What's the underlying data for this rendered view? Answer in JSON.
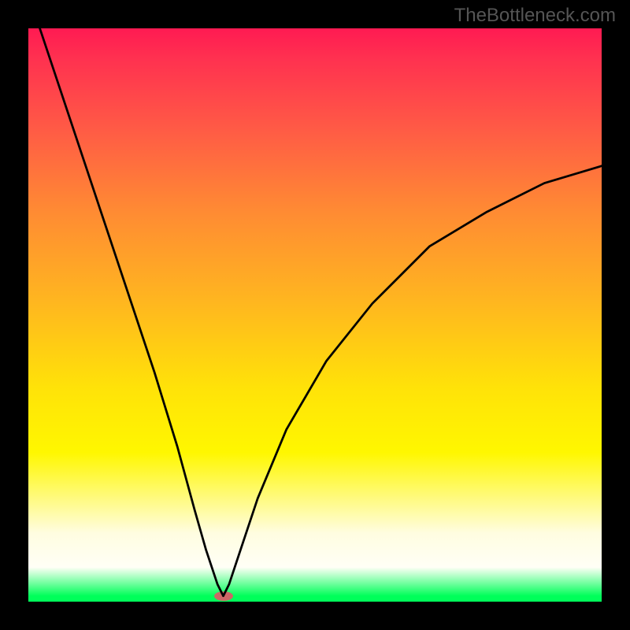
{
  "watermark": "TheBottleneck.com",
  "chart_data": {
    "type": "line",
    "title": "",
    "xlabel": "",
    "ylabel": "",
    "xlim": [
      0,
      100
    ],
    "ylim": [
      0,
      100
    ],
    "grid": false,
    "gradient_stops": [
      {
        "pos": 0,
        "color": "#ff1a52"
      },
      {
        "pos": 5,
        "color": "#ff3050"
      },
      {
        "pos": 18,
        "color": "#ff5c45"
      },
      {
        "pos": 32,
        "color": "#ff8b33"
      },
      {
        "pos": 48,
        "color": "#ffb71f"
      },
      {
        "pos": 63,
        "color": "#ffe308"
      },
      {
        "pos": 74,
        "color": "#fff700"
      },
      {
        "pos": 88,
        "color": "#fffde0"
      },
      {
        "pos": 94,
        "color": "#fffff6"
      },
      {
        "pos": 99,
        "color": "#00ff5a"
      },
      {
        "pos": 100,
        "color": "#00ff5a"
      }
    ],
    "minimum_point": {
      "x": 34,
      "y": 1
    },
    "series": [
      {
        "name": "curve",
        "points": [
          {
            "x": 2,
            "y": 100
          },
          {
            "x": 6,
            "y": 88
          },
          {
            "x": 10,
            "y": 76
          },
          {
            "x": 14,
            "y": 64
          },
          {
            "x": 18,
            "y": 52
          },
          {
            "x": 22,
            "y": 40
          },
          {
            "x": 26,
            "y": 27
          },
          {
            "x": 29,
            "y": 16
          },
          {
            "x": 31,
            "y": 9
          },
          {
            "x": 33,
            "y": 3
          },
          {
            "x": 34,
            "y": 1
          },
          {
            "x": 35,
            "y": 3
          },
          {
            "x": 37,
            "y": 9
          },
          {
            "x": 40,
            "y": 18
          },
          {
            "x": 45,
            "y": 30
          },
          {
            "x": 52,
            "y": 42
          },
          {
            "x": 60,
            "y": 52
          },
          {
            "x": 70,
            "y": 62
          },
          {
            "x": 80,
            "y": 68
          },
          {
            "x": 90,
            "y": 73
          },
          {
            "x": 100,
            "y": 76
          }
        ]
      }
    ]
  }
}
